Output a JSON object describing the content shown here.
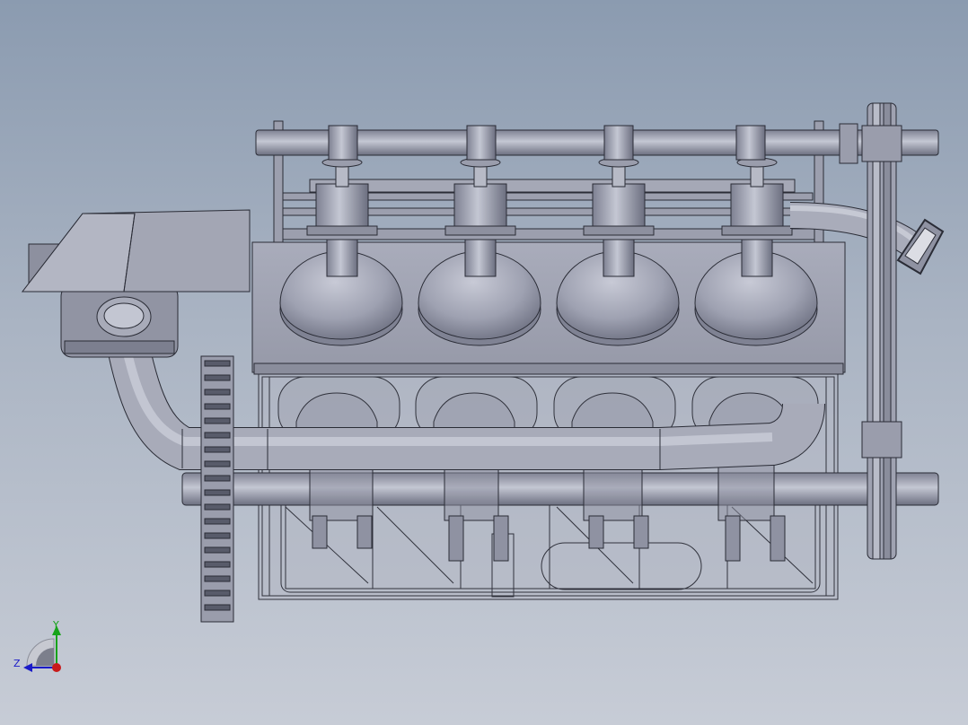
{
  "viewport": {
    "background_top": "#8b9bb0",
    "background_bottom": "#c7ccd6"
  },
  "model": {
    "name": "inline-four-engine-assembly",
    "cylinder_count": 4,
    "part_color": "#a4a7b5",
    "edge_color": "#2a2c36"
  },
  "triad": {
    "x_label": "",
    "y_label": "Y",
    "z_label": "Z",
    "y_color": "#17a31a",
    "z_color": "#1a1ac8",
    "x_color": "#c81a1a"
  }
}
